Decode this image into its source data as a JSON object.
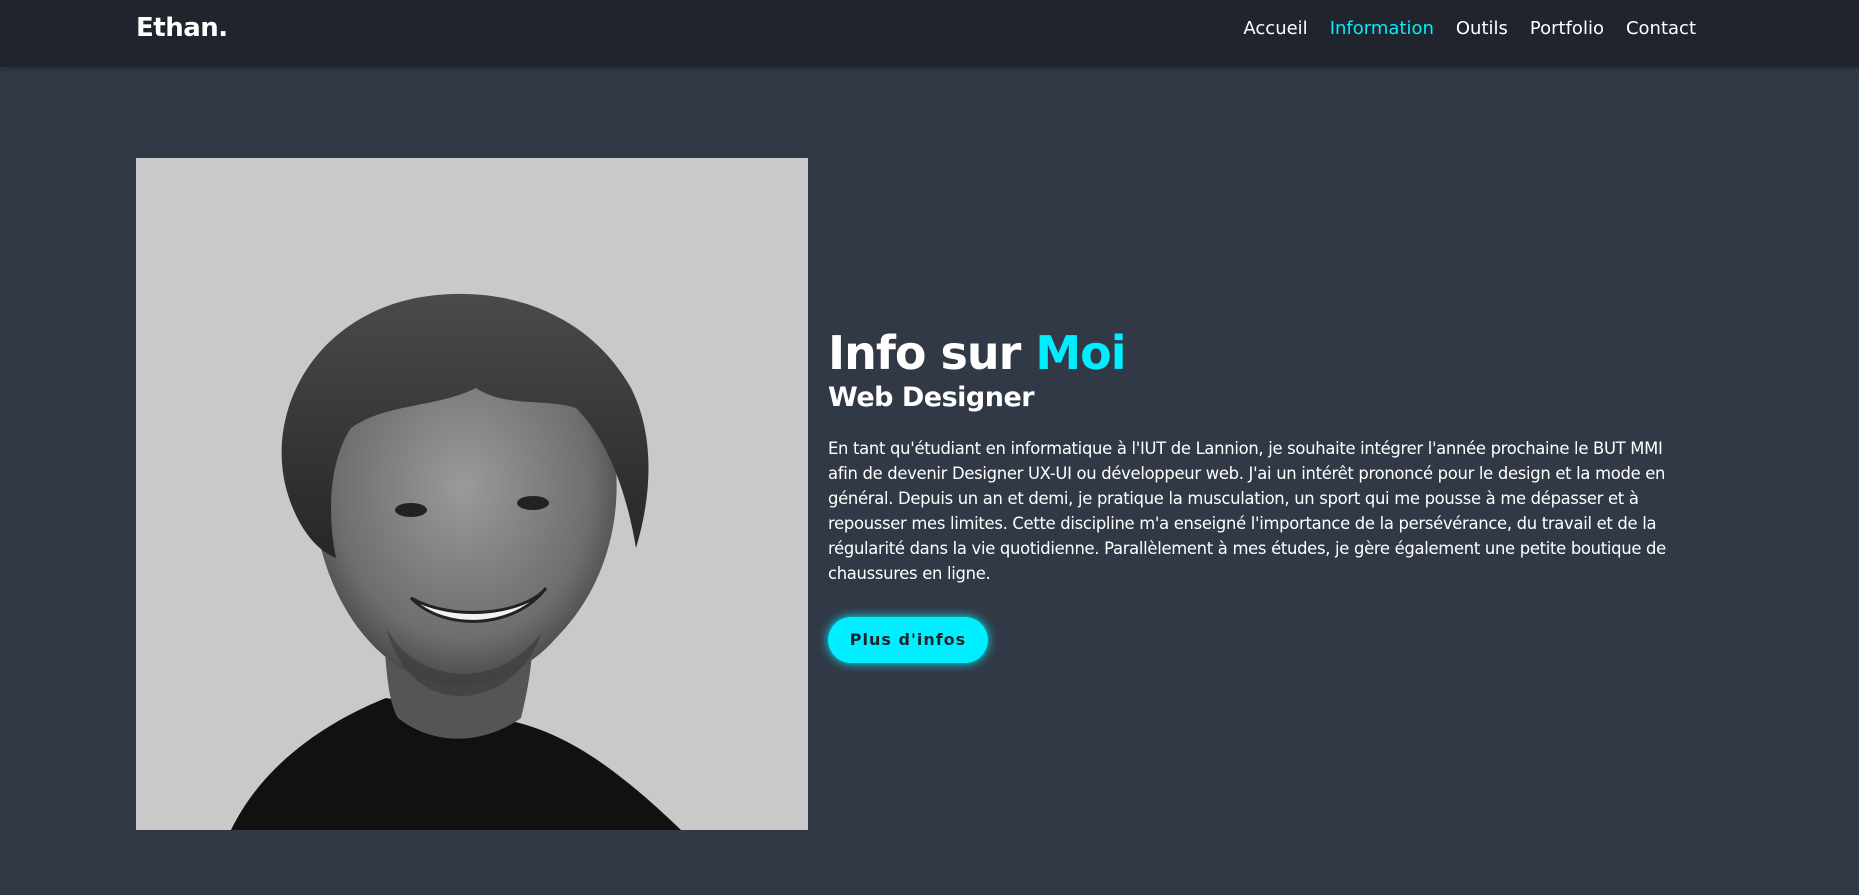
{
  "header": {
    "logo": "Ethan.",
    "nav": [
      {
        "label": "Accueil"
      },
      {
        "label": "Information"
      },
      {
        "label": "Outils"
      },
      {
        "label": "Portfolio"
      },
      {
        "label": "Contact"
      }
    ],
    "active_index": 1
  },
  "about": {
    "title_main": "Info sur ",
    "title_accent": "Moi",
    "subtitle": "Web Designer",
    "bio": "En tant qu'étudiant en informatique à l'IUT de Lannion, je souhaite intégrer l'année prochaine le BUT MMI afin de devenir Designer UX-UI ou développeur web. J'ai un intérêt prononcé pour le design et la mode en général. Depuis un an et demi, je pratique la musculation, un sport qui me pousse à me dépasser et à repousser mes limites. Cette discipline m'a enseigné l'importance de la persévérance, du travail et de la régularité dans la vie quotidienne. Parallèlement à mes études, je gère également une petite boutique de chaussures en ligne.",
    "button_label": "Plus d'infos"
  },
  "colors": {
    "background": "#323946",
    "header_bg": "#1f242d",
    "accent": "#00eeff",
    "photo_bg": "#c9c9c9"
  }
}
